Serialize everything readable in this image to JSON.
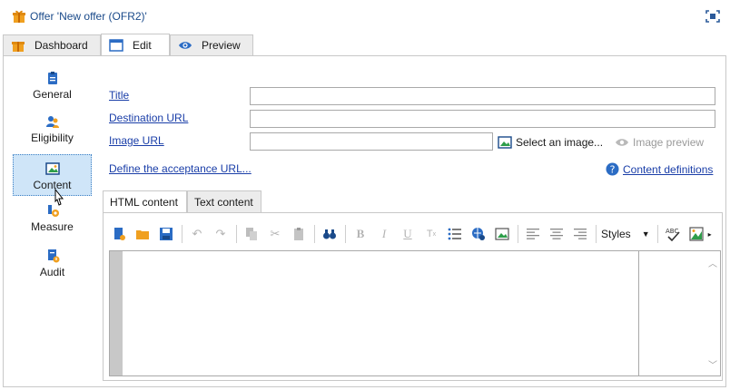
{
  "window": {
    "title": "Offer 'New offer (OFR2)'"
  },
  "tabs": [
    {
      "label": "Dashboard",
      "icon": "gift-icon"
    },
    {
      "label": "Edit",
      "icon": "window-edit-icon"
    },
    {
      "label": "Preview",
      "icon": "eye-icon"
    }
  ],
  "sidebar": {
    "items": [
      {
        "label": "General",
        "icon": "clipboard-icon"
      },
      {
        "label": "Eligibility",
        "icon": "users-icon"
      },
      {
        "label": "Content",
        "icon": "image-icon"
      },
      {
        "label": "Measure",
        "icon": "measure-icon"
      },
      {
        "label": "Audit",
        "icon": "audit-icon"
      }
    ]
  },
  "form": {
    "title_label": "Title",
    "title_value": "",
    "destination_label": "Destination URL",
    "destination_value": "",
    "image_label": "Image URL",
    "image_value": "",
    "select_image": "Select an image...",
    "image_preview": "Image preview",
    "acceptance_link": "Define the acceptance URL...",
    "content_definitions": "Content definitions"
  },
  "content_tabs": [
    {
      "label": "HTML content"
    },
    {
      "label": "Text content"
    }
  ],
  "editor": {
    "styles_label": "Styles",
    "body_text": ""
  },
  "colors": {
    "link": "#1a3ea8",
    "accent_orange": "#f0a020",
    "accent_blue": "#2b6cc4",
    "selected_bg": "#cfe5f8"
  }
}
